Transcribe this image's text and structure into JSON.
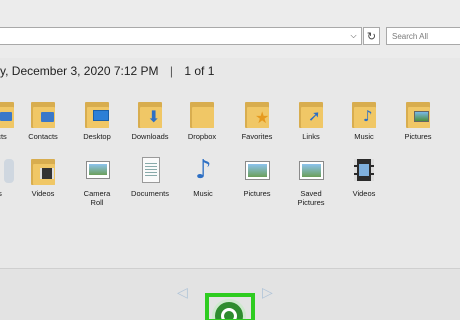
{
  "toolbar": {
    "address_value": "",
    "address_dropdown_glyph": "⌵",
    "refresh_glyph": "↻",
    "search_placeholder": "Search All"
  },
  "photo_info": {
    "date_text": "y, December 3, 2020 7:12 PM",
    "separator": "|",
    "counter_text": "1 of 1"
  },
  "row1": [
    {
      "label": "cts",
      "icon": "contacts-folder-icon"
    },
    {
      "label": "Contacts",
      "icon": "contacts-folder-icon"
    },
    {
      "label": "Desktop",
      "icon": "desktop-folder-icon"
    },
    {
      "label": "Downloads",
      "icon": "downloads-folder-icon"
    },
    {
      "label": "Dropbox",
      "icon": "folder-icon"
    },
    {
      "label": "Favorites",
      "icon": "favorites-folder-icon"
    },
    {
      "label": "Links",
      "icon": "links-folder-icon"
    },
    {
      "label": "Music",
      "icon": "music-folder-icon"
    },
    {
      "label": "Pictures",
      "icon": "pictures-folder-icon"
    }
  ],
  "row2": [
    {
      "label": "s",
      "icon": "folder-icon"
    },
    {
      "label": "Videos",
      "icon": "videos-folder-icon"
    },
    {
      "label": "Camera\nRoll",
      "icon": "camera-roll-icon"
    },
    {
      "label": "Documents",
      "icon": "documents-icon"
    },
    {
      "label": "Music",
      "icon": "music-library-icon"
    },
    {
      "label": "Pictures",
      "icon": "pictures-library-icon"
    },
    {
      "label": "Saved\nPictures",
      "icon": "saved-pictures-icon"
    },
    {
      "label": "Videos",
      "icon": "videos-library-icon"
    }
  ],
  "bottom_bar": {
    "prev_glyph": "◁",
    "next_glyph": "▷",
    "rotate_button_label": ""
  }
}
